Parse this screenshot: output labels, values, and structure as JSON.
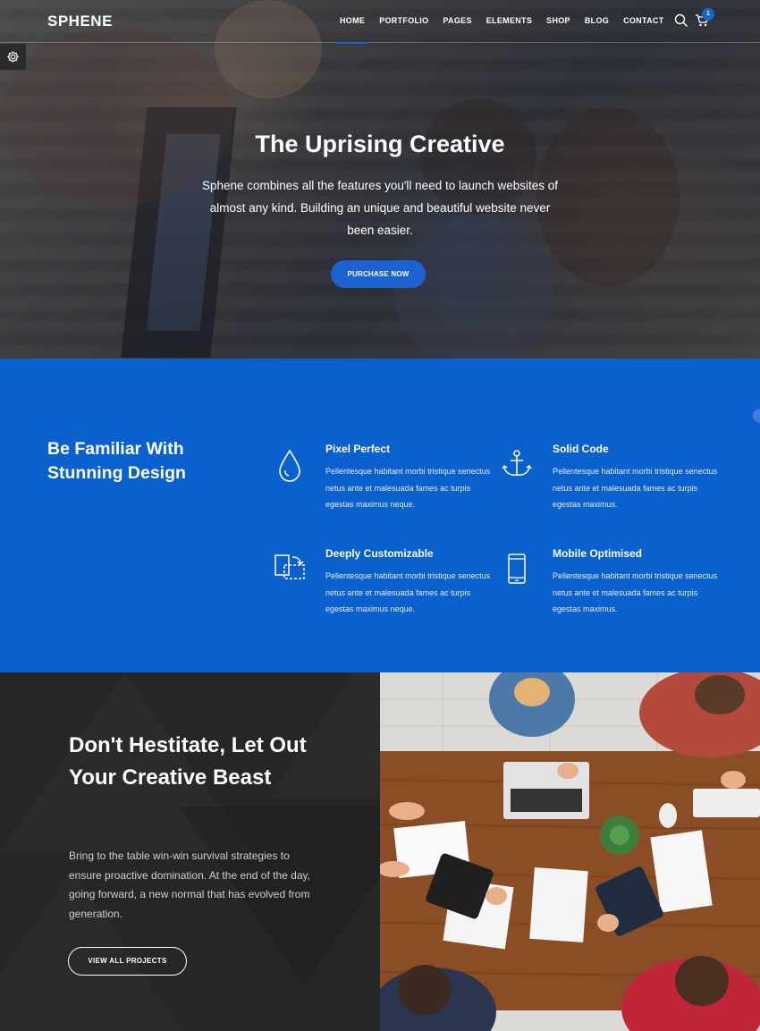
{
  "header": {
    "logo": "SPHENE",
    "nav": [
      "HOME",
      "PORTFOLIO",
      "PAGES",
      "ELEMENTS",
      "SHOP",
      "BLOG",
      "CONTACT"
    ],
    "active_nav": "HOME",
    "cart_count": "1",
    "icons": {
      "search": "search-icon",
      "cart": "cart-icon",
      "settings": "gear-icon"
    }
  },
  "hero": {
    "title": "The Uprising Creative",
    "text": "Sphene combines all the features you'll need to launch websites of almost any kind. Building an unique and beautiful website never been easier.",
    "button": "PURCHASE NOW"
  },
  "features": {
    "title": "Be Familiar With Stunning Design",
    "items": [
      {
        "icon": "drop-icon",
        "name": "Pixel Perfect",
        "desc": "Pellentesque habitant morbi tristique senectus netus ante et malesuada fames ac turpis egestas maximus neque."
      },
      {
        "icon": "anchor-icon",
        "name": "Solid Code",
        "desc": "Pellentesque habitant morbi tristique senectus netus ante et malesuada fames ac turpis egestas maximus."
      },
      {
        "icon": "customize-icon",
        "name": "Deeply Customizable",
        "desc": "Pellentesque habitant morbi tristique senectus netus ante et malesuada fames ac turpis egestas maximus neque."
      },
      {
        "icon": "mobile-icon",
        "name": "Mobile Optimised",
        "desc": "Pellentesque habitant morbi tristique senectus netus ante et malesuada fames ac turpis egestas maximus."
      }
    ]
  },
  "promo": {
    "title": "Don't Hestitate, Let Out Your Creative Beast",
    "text": "Bring to the table win-win survival strategies to ensure proactive domination. At the end of the day, going forward, a new normal that has evolved from generation.",
    "button": "VIEW ALL PROJECTS"
  },
  "colors": {
    "accent": "#0a60cc",
    "dark": "#262626"
  }
}
